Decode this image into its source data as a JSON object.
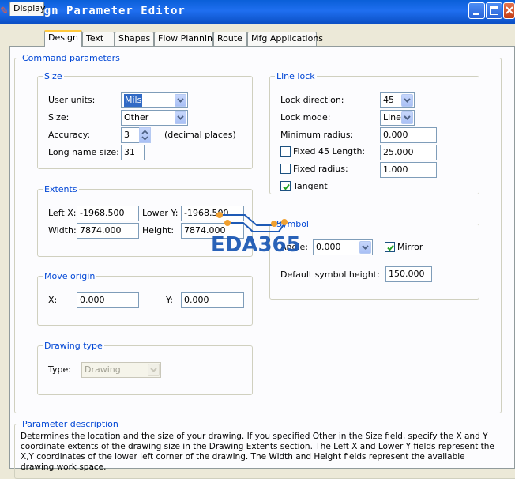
{
  "window": {
    "title": "Design Parameter Editor"
  },
  "tabs": [
    {
      "label": "Display"
    },
    {
      "label": "Design"
    },
    {
      "label": "Text"
    },
    {
      "label": "Shapes"
    },
    {
      "label": "Flow Planning"
    },
    {
      "label": "Route"
    },
    {
      "label": "Mfg Applications"
    }
  ],
  "active_tab": "Design",
  "command_parameters": {
    "label": "Command parameters"
  },
  "size": {
    "label": "Size",
    "user_units_label": "User units:",
    "user_units_value": "Mils",
    "size_label": "Size:",
    "size_value": "Other",
    "accuracy_label": "Accuracy:",
    "accuracy_value": "3",
    "accuracy_suffix": "(decimal places)",
    "long_name_label": "Long name size:",
    "long_name_value": "31"
  },
  "extents": {
    "label": "Extents",
    "left_x_label": "Left X:",
    "left_x_value": "-1968.500",
    "lower_y_label": "Lower Y:",
    "lower_y_value": "-1968.500",
    "width_label": "Width:",
    "width_value": "7874.000",
    "height_label": "Height:",
    "height_value": "7874.000"
  },
  "move_origin": {
    "label": "Move origin",
    "x_label": "X:",
    "x_value": "0.000",
    "y_label": "Y:",
    "y_value": "0.000"
  },
  "drawing_type": {
    "label": "Drawing type",
    "type_label": "Type:",
    "type_value": "Drawing"
  },
  "line_lock": {
    "label": "Line lock",
    "lock_direction_label": "Lock direction:",
    "lock_direction_value": "45",
    "lock_mode_label": "Lock mode:",
    "lock_mode_value": "Line",
    "min_radius_label": "Minimum radius:",
    "min_radius_value": "0.000",
    "fixed45_label": "Fixed 45 Length:",
    "fixed45_value": "25.000",
    "fixed45_checked": false,
    "fixed_radius_label": "Fixed radius:",
    "fixed_radius_value": "1.000",
    "fixed_radius_checked": false,
    "tangent_label": "Tangent",
    "tangent_checked": true
  },
  "symbol": {
    "label": "Symbol",
    "angle_label": "Angle:",
    "angle_value": "0.000",
    "mirror_label": "Mirror",
    "mirror_checked": true,
    "default_height_label": "Default symbol height:",
    "default_height_value": "150.000"
  },
  "parameter_description": {
    "label": "Parameter description",
    "text": "Determines the location and the size of your drawing.  If you specified Other in the Size field, specify the X and Y coordinate extents of the drawing size in the Drawing Extents section. The Left X and Lower Y fields represent the X,Y coordinates of the lower left corner of the drawing.  The Width and Height fields represent the available drawing work space."
  },
  "watermark": {
    "text": "EDA365"
  },
  "colors": {
    "titlebar": "#0a5fd8",
    "group_label": "#0046d5",
    "tab_highlight": "#ffc83c"
  }
}
